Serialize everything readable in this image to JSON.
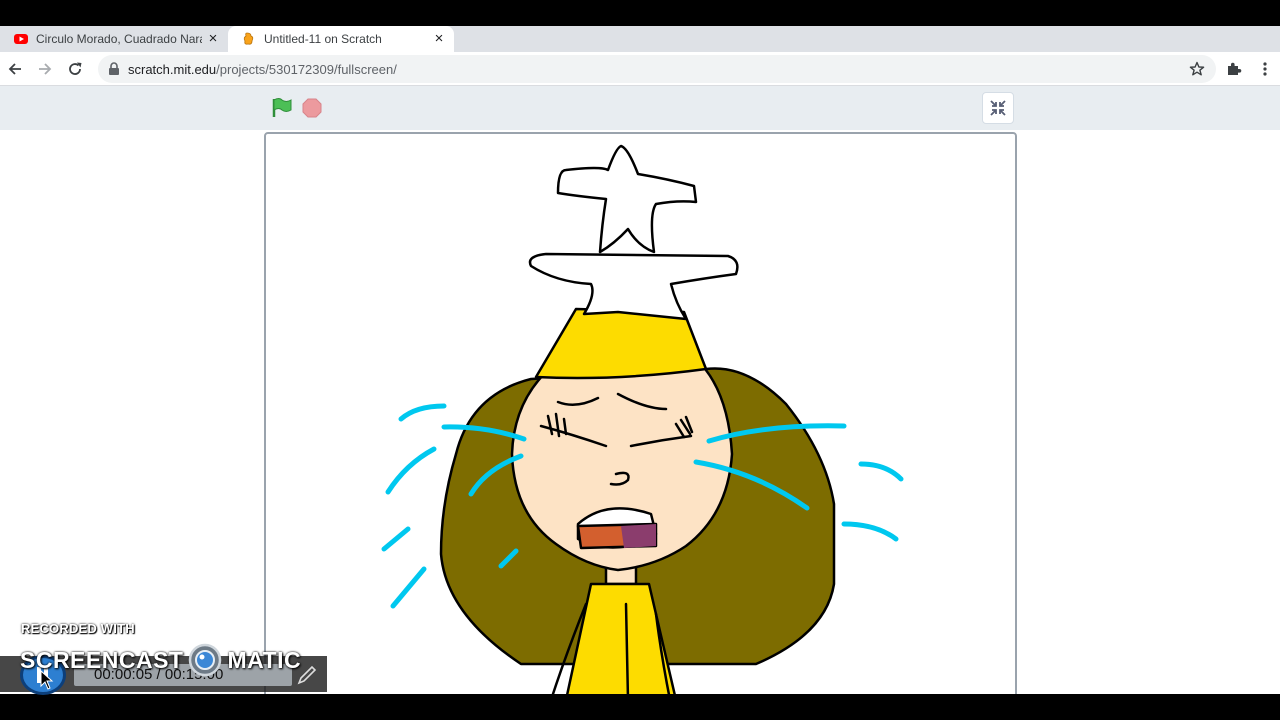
{
  "browser": {
    "tabs": [
      {
        "title": "Circulo Morado, Cuadrado Naranja",
        "icon": "youtube-icon",
        "active": false
      },
      {
        "title": "Untitled-11 on Scratch",
        "icon": "scratch-icon",
        "active": true
      }
    ],
    "close_glyph": "×",
    "new_tab_glyph": "+",
    "url_host": "scratch.mit.edu",
    "url_path": "/projects/530172309/fullscreen/"
  },
  "scratch": {
    "green_flag_icon": "green-flag-icon",
    "stop_icon": "stop-icon",
    "exit_fullscreen_icon": "exit-fullscreen-icon"
  },
  "recorder": {
    "recorded_with": "RECORDED WITH",
    "brand": "SCREENCAST",
    "brand_suffix": "MATIC",
    "time_elapsed": "00:00:05",
    "time_total": "00:15:00",
    "time_display": "00:00:05 / 00:15:00"
  },
  "colors": {
    "hat": "#ffffff",
    "crown": "#fddc00",
    "hair": "#7d6c00",
    "skin": "#fde3c5",
    "tears": "#00c8ef",
    "mouth": "#d35f2e",
    "tongue": "#8b3d6d",
    "shirt": "#fddc00",
    "flag": "#4cbf56",
    "stop": "#ec9a9e"
  }
}
